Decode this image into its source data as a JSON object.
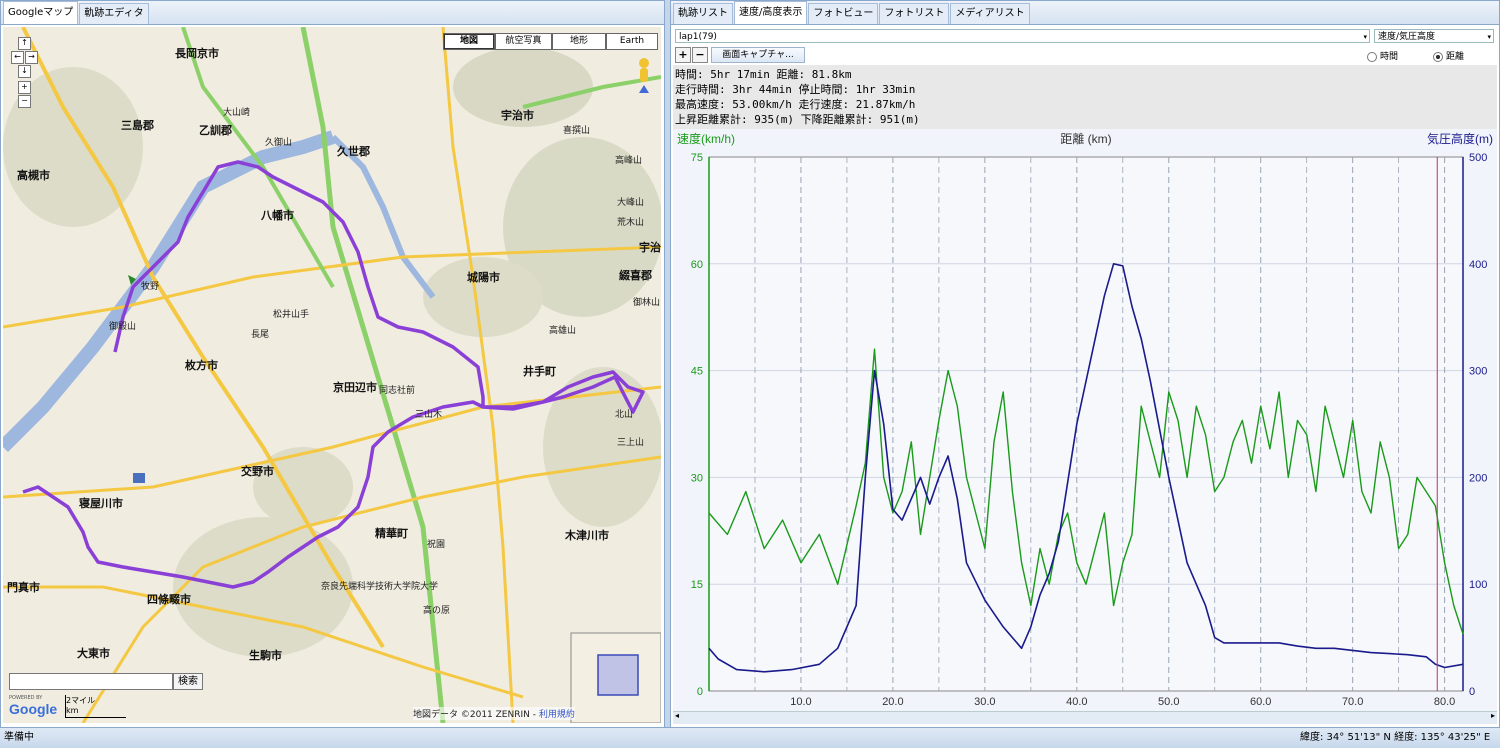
{
  "left_tabs": [
    "Googleマップ",
    "軌跡エディタ"
  ],
  "map": {
    "types": [
      "地図",
      "航空写真",
      "地形",
      "Earth"
    ],
    "selected_type": "地図",
    "search_button": "検索",
    "search_value": "",
    "scale": [
      "2マイル",
      "km"
    ],
    "copyright": "地図データ ©2011 ZENRIN -",
    "terms": "利用規約",
    "powered_by": "POWERED BY",
    "logo": "Google",
    "nav": [
      "↑",
      "←",
      "→",
      "↓",
      "+",
      "−"
    ],
    "labels": [
      {
        "t": "長岡京市",
        "big": true
      },
      {
        "t": "乙訓郡",
        "big": true
      },
      {
        "t": "三島郡",
        "big": true
      },
      {
        "t": "高槻市",
        "big": true
      },
      {
        "t": "久世郡",
        "big": true
      },
      {
        "t": "宇治市",
        "big": true
      },
      {
        "t": "八幡市",
        "big": true
      },
      {
        "t": "城陽市",
        "big": true
      },
      {
        "t": "枚方市",
        "big": true
      },
      {
        "t": "京田辺市",
        "big": true
      },
      {
        "t": "井手町",
        "big": true
      },
      {
        "t": "交野市",
        "big": true
      },
      {
        "t": "寝屋川市",
        "big": true
      },
      {
        "t": "精華町",
        "big": true
      },
      {
        "t": "木津川市",
        "big": true
      },
      {
        "t": "四條畷市",
        "big": true
      },
      {
        "t": "大東市",
        "big": true
      },
      {
        "t": "生駒市",
        "big": true
      },
      {
        "t": "綴喜郡",
        "big": true
      },
      {
        "t": "門真市",
        "big": true
      },
      {
        "t": "宇治",
        "big": true
      },
      {
        "t": "大山崎",
        "big": false
      },
      {
        "t": "久御山",
        "big": false
      },
      {
        "t": "牧野",
        "big": false
      },
      {
        "t": "御殿山",
        "big": false
      },
      {
        "t": "長尾",
        "big": false
      },
      {
        "t": "松井山手",
        "big": false
      },
      {
        "t": "同志社前",
        "big": false
      },
      {
        "t": "三山木",
        "big": false
      },
      {
        "t": "祝園",
        "big": false
      },
      {
        "t": "高の原",
        "big": false
      },
      {
        "t": "奈良先端科学技術大学院大学",
        "big": false
      },
      {
        "t": "喜撰山",
        "big": false
      },
      {
        "t": "高雄山",
        "big": false
      },
      {
        "t": "北山",
        "big": false
      },
      {
        "t": "三上山",
        "big": false
      },
      {
        "t": "大峰山",
        "big": false
      },
      {
        "t": "荒木山",
        "big": false
      },
      {
        "t": "御林山",
        "big": false
      },
      {
        "t": "高峰山",
        "big": false
      }
    ]
  },
  "right_tabs": [
    "軌跡リスト",
    "速度/高度表示",
    "フォトビュー",
    "フォトリスト",
    "メディアリスト"
  ],
  "right_active_tab": 1,
  "lap_select": "lap1(79)",
  "mode_select": "速度/気圧高度",
  "zoom_in": "+",
  "zoom_out": "−",
  "capture_button": "画面キャプチャ...",
  "radio": {
    "time": "時間",
    "distance": "距離",
    "selected": "distance"
  },
  "stats": [
    "時間: 5hr 17min 距離: 81.8km",
    "走行時間: 3hr 44min 停止時間: 1hr 33min",
    "最高速度: 53.00km/h 走行速度: 21.87km/h",
    "上昇距離累計: 935(m) 下降距離累計: 951(m)"
  ],
  "status_left": "準備中",
  "status_right": "緯度: 34° 51'13\" N  経度: 135° 43'25\" E",
  "colors": {
    "speed": "#1a9a1a",
    "altitude": "#1a1a8c",
    "route": "#8a3fd6",
    "marker": "#c0306a"
  },
  "chart_data": {
    "type": "line",
    "xlabel": "距離 (km)",
    "ylabel_left": "速度(km/h)",
    "ylabel_right": "気圧高度(m)",
    "x_ticks": [
      "10.0",
      "20.0",
      "30.0",
      "40.0",
      "50.0",
      "60.0",
      "70.0",
      "80.0"
    ],
    "y_left_ticks": [
      "75",
      "60",
      "45",
      "30",
      "15",
      "0"
    ],
    "y_right_ticks": [
      "500",
      "400",
      "300",
      "200",
      "100",
      "0"
    ],
    "xlim": [
      0,
      82
    ],
    "ylim_left": [
      0,
      75
    ],
    "ylim_right": [
      0,
      500
    ],
    "marker_x": 79.2,
    "series": [
      {
        "name": "速度(km/h)",
        "axis": "left",
        "x": [
          0,
          2,
          4,
          6,
          8,
          10,
          12,
          14,
          16,
          17,
          18,
          19,
          20,
          21,
          22,
          23,
          24,
          25,
          26,
          27,
          28,
          29,
          30,
          31,
          32,
          33,
          34,
          35,
          36,
          37,
          38,
          39,
          40,
          41,
          42,
          43,
          44,
          45,
          46,
          47,
          48,
          49,
          50,
          51,
          52,
          53,
          54,
          55,
          56,
          57,
          58,
          59,
          60,
          61,
          62,
          63,
          64,
          65,
          66,
          67,
          68,
          69,
          70,
          71,
          72,
          73,
          74,
          75,
          76,
          77,
          78,
          79,
          80,
          81,
          82
        ],
        "y": [
          25,
          22,
          28,
          20,
          24,
          18,
          22,
          15,
          26,
          32,
          48,
          30,
          25,
          28,
          35,
          22,
          30,
          38,
          45,
          40,
          30,
          25,
          20,
          35,
          42,
          28,
          18,
          12,
          20,
          15,
          22,
          25,
          18,
          15,
          20,
          25,
          12,
          18,
          22,
          40,
          35,
          30,
          42,
          38,
          30,
          40,
          36,
          28,
          30,
          35,
          38,
          32,
          40,
          34,
          42,
          30,
          38,
          36,
          28,
          40,
          35,
          30,
          38,
          28,
          25,
          35,
          30,
          20,
          22,
          30,
          28,
          26,
          18,
          12,
          8
        ]
      },
      {
        "name": "気圧高度(m)",
        "axis": "right",
        "x": [
          0,
          1,
          3,
          6,
          9,
          12,
          14,
          16,
          17,
          18,
          19,
          20,
          21,
          22,
          23,
          24,
          25,
          26,
          27,
          28,
          30,
          32,
          34,
          35,
          36,
          37,
          38,
          40,
          42,
          43,
          44,
          45,
          46,
          47,
          48,
          50,
          52,
          54,
          55,
          56,
          58,
          60,
          62,
          64,
          66,
          68,
          70,
          72,
          74,
          76,
          78,
          79,
          80,
          82
        ],
        "y": [
          40,
          30,
          20,
          18,
          20,
          25,
          40,
          80,
          200,
          300,
          250,
          170,
          160,
          180,
          200,
          175,
          200,
          220,
          180,
          120,
          85,
          60,
          40,
          60,
          90,
          110,
          140,
          250,
          330,
          370,
          400,
          398,
          360,
          330,
          290,
          200,
          120,
          80,
          50,
          45,
          45,
          45,
          45,
          42,
          40,
          40,
          38,
          36,
          35,
          34,
          32,
          25,
          22,
          25
        ]
      }
    ]
  }
}
